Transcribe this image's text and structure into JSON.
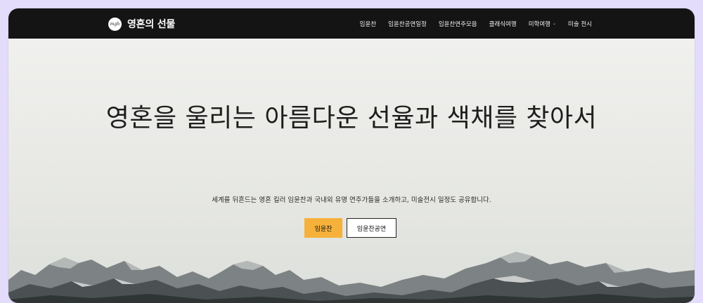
{
  "site": {
    "title": "영혼의 선물",
    "logo_text": "mgh"
  },
  "nav": {
    "items": [
      {
        "label": "임윤찬"
      },
      {
        "label": "임윤찬공연일정"
      },
      {
        "label": "임윤찬연주모음"
      },
      {
        "label": "클래식여행"
      },
      {
        "label": "미학여행",
        "has_dropdown": true
      },
      {
        "label": "미술 전시"
      }
    ]
  },
  "hero": {
    "heading": "영혼을 울리는 아름다운 선율과 색채를 찾아서",
    "subheading": "세계를 뒤흔드는 영혼 킬러 임윤찬과 국내외 유명 연주가들을 소개하고, 미술전시 일정도 공유합니다.",
    "primary_button": "임윤찬",
    "secondary_button": "임윤찬공연"
  },
  "colors": {
    "nav_bg": "#141414",
    "accent": "#f6b13a",
    "outer_bg": "#e3dcfb"
  }
}
